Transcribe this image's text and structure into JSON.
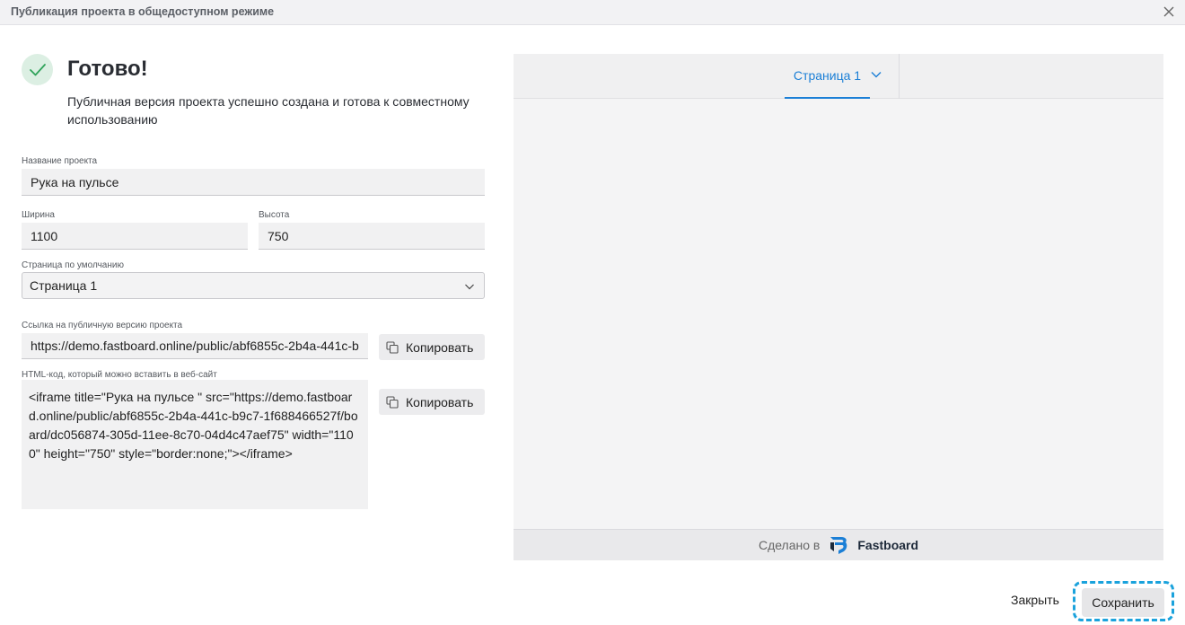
{
  "dialog": {
    "title": "Публикация проекта в общедоступном режиме"
  },
  "status": {
    "heading": "Готово!",
    "message": "Публичная версия проекта успешно создана и готова к совместному использованию"
  },
  "form": {
    "name_label": "Название проекта",
    "name_value": "Рука на пульсе",
    "width_label": "Ширина",
    "width_value": "1100",
    "height_label": "Высота",
    "height_value": "750",
    "default_page_label": "Страница по умолчанию",
    "default_page_value": "Страница 1",
    "link_label": "Ссылка на публичную версию проекта",
    "link_value": "https://demo.fastboard.online/public/abf6855c-2b4a-441c-b",
    "embed_label": "HTML-код, который можно вставить в веб-сайт",
    "embed_value": "<iframe title=\"Рука на пульсе \" src=\"https://demo.fastboard.online/public/abf6855c-2b4a-441c-b9c7-1f688466527f/board/dc056874-305d-11ee-8c70-04d4c47aef75\" width=\"1100\" height=\"750\" style=\"border:none;\"></iframe>",
    "copy_label": "Копировать"
  },
  "preview": {
    "tab_label": "Страница 1",
    "footer_made_in": "Сделано в",
    "footer_brand": "Fastboard"
  },
  "actions": {
    "close_label": "Закрыть",
    "save_label": "Сохранить"
  },
  "colors": {
    "accent": "#1b7fd6",
    "success": "#2fa35a",
    "focus_ring": "#1aa2dc"
  },
  "icons": [
    "close-icon",
    "check-icon",
    "chevron-down-icon",
    "copy-icon",
    "fastboard-logo"
  ]
}
